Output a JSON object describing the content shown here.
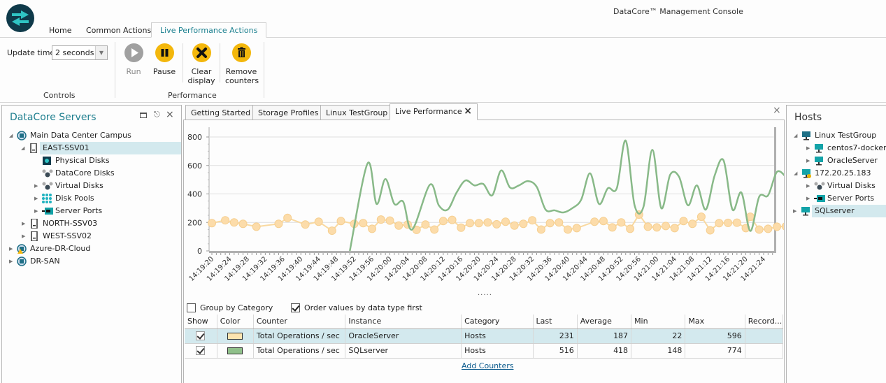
{
  "app": {
    "title": "DataCore™ Management Console",
    "logo_icon": "swap-arrows-icon"
  },
  "ribbon": {
    "tabs": [
      {
        "label": "Home",
        "active": false
      },
      {
        "label": "Common Actions",
        "active": false
      },
      {
        "label": "Live Performance Actions",
        "active": true
      }
    ],
    "controls": {
      "update_time_label": "Update time:",
      "update_time_value": "2 seconds",
      "group_label": "Controls"
    },
    "performance": {
      "group_label": "Performance",
      "buttons": [
        {
          "label": "Run",
          "icon": "play-icon",
          "enabled": false
        },
        {
          "label": "Pause",
          "icon": "pause-icon",
          "enabled": true
        },
        {
          "label_line1": "Clear",
          "label_line2": "display",
          "icon": "clear-x-icon",
          "enabled": true
        },
        {
          "label_line1": "Remove",
          "label_line2": "counters",
          "icon": "trash-icon",
          "enabled": true
        }
      ]
    }
  },
  "left_panel": {
    "title": "DataCore Servers",
    "buttons": {
      "maximize": "maximize-icon",
      "pin": "pin-icon",
      "close": "close-icon"
    },
    "tree": [
      {
        "label": "Main Data Center Campus",
        "level": 0,
        "expanded": true,
        "icon": "server-group-icon"
      },
      {
        "label": "EAST-SSV01",
        "level": 1,
        "expanded": true,
        "selected": true,
        "icon": "server-icon"
      },
      {
        "label": "Physical Disks",
        "level": 2,
        "icon": "physical-disk-icon"
      },
      {
        "label": "DataCore Disks",
        "level": 2,
        "icon": "datacore-disks-icon"
      },
      {
        "label": "Virtual Disks",
        "level": 2,
        "collapsed": true,
        "icon": "virtual-disks-icon"
      },
      {
        "label": "Disk Pools",
        "level": 2,
        "collapsed": true,
        "icon": "disk-pools-icon"
      },
      {
        "label": "Server Ports",
        "level": 2,
        "collapsed": true,
        "icon": "server-ports-icon"
      },
      {
        "label": "NORTH-SSV03",
        "level": 1,
        "collapsed": true,
        "icon": "server-icon"
      },
      {
        "label": "WEST-SSV02",
        "level": 1,
        "collapsed": true,
        "icon": "server-icon"
      },
      {
        "label": "Azure-DR-Cloud",
        "level": 0,
        "collapsed": true,
        "icon": "server-group-warning-icon"
      },
      {
        "label": "DR-SAN",
        "level": 0,
        "collapsed": true,
        "icon": "server-group-icon"
      }
    ]
  },
  "right_panel": {
    "title": "Hosts",
    "tree": [
      {
        "label": "Linux TestGroup",
        "level": 0,
        "expanded": true,
        "icon": "host-group-icon"
      },
      {
        "label": "centos7-docker",
        "level": 1,
        "collapsed": true,
        "icon": "host-icon"
      },
      {
        "label": "OracleServer",
        "level": 1,
        "collapsed": true,
        "icon": "host-icon"
      },
      {
        "label": "172.20.25.183",
        "level": 0,
        "expanded": true,
        "icon": "host-warning-icon"
      },
      {
        "label": "Virtual Disks",
        "level": 1,
        "collapsed": true,
        "icon": "virtual-disks-icon"
      },
      {
        "label": "Server Ports",
        "level": 1,
        "collapsed": true,
        "icon": "server-ports-icon"
      },
      {
        "label": "SQLserver",
        "level": 0,
        "collapsed": true,
        "selected": true,
        "icon": "host-icon"
      }
    ]
  },
  "doc_tabs": [
    {
      "label": "Getting Started",
      "active": false
    },
    {
      "label": "Storage Profiles",
      "active": false
    },
    {
      "label": "Linux TestGroup",
      "active": false
    },
    {
      "label": "Live Performance",
      "active": true,
      "closable": true
    }
  ],
  "chart_data": {
    "type": "line",
    "title": "",
    "xlabel": "",
    "ylabel": "",
    "ylim": [
      0,
      850
    ],
    "yticks": [
      0,
      200,
      400,
      600,
      800
    ],
    "grid": true,
    "xtick_labels": [
      "14:19:20",
      "14:19:24",
      "14:19:28",
      "14:19:32",
      "14:19:36",
      "14:19:40",
      "14:19:44",
      "14:19:48",
      "14:19:52",
      "14:19:56",
      "14:20:00",
      "14:20:04",
      "14:20:08",
      "14:20:12",
      "14:20:16",
      "14:20:20",
      "14:20:24",
      "14:20:28",
      "14:20:32",
      "14:20:36",
      "14:20:40",
      "14:20:44",
      "14:20:48",
      "14:20:52",
      "14:20:56",
      "14:21:00",
      "14:21:04",
      "14:21:08",
      "14:21:12",
      "14:21:16",
      "14:21:20",
      "14:21:24"
    ],
    "x_seconds_start": 0,
    "x_seconds_end": 128,
    "series": [
      {
        "name": "OracleServer - Total Operations / sec",
        "color": "#f9d9a0",
        "markers": true,
        "smooth": false,
        "points": [
          [
            0,
            195
          ],
          [
            3,
            215
          ],
          [
            5,
            200
          ],
          [
            7,
            190
          ],
          [
            10,
            170
          ],
          [
            15,
            190
          ],
          [
            17,
            232
          ],
          [
            21,
            185
          ],
          [
            24,
            205
          ],
          [
            27,
            142
          ],
          [
            29,
            210
          ],
          [
            32,
            190
          ],
          [
            34,
            195
          ],
          [
            36,
            155
          ],
          [
            38,
            220
          ],
          [
            40,
            213
          ],
          [
            42,
            178
          ],
          [
            44,
            185
          ],
          [
            46,
            148
          ],
          [
            48,
            185
          ],
          [
            50,
            150
          ],
          [
            52,
            210
          ],
          [
            54,
            218
          ],
          [
            56,
            163
          ],
          [
            58,
            195
          ],
          [
            60,
            195
          ],
          [
            62,
            200
          ],
          [
            64,
            187
          ],
          [
            66,
            205
          ],
          [
            68,
            178
          ],
          [
            70,
            190
          ],
          [
            72,
            215
          ],
          [
            74,
            150
          ],
          [
            76,
            195
          ],
          [
            78,
            200
          ],
          [
            80,
            150
          ],
          [
            82,
            160
          ],
          [
            86,
            205
          ],
          [
            88,
            210
          ],
          [
            90,
            165
          ],
          [
            92,
            200
          ],
          [
            94,
            155
          ],
          [
            96,
            255
          ],
          [
            98,
            170
          ],
          [
            100,
            165
          ],
          [
            102,
            175
          ],
          [
            104,
            160
          ],
          [
            106,
            210
          ],
          [
            108,
            190
          ],
          [
            110,
            240
          ],
          [
            112,
            145
          ],
          [
            114,
            195
          ],
          [
            116,
            197
          ],
          [
            118,
            198
          ],
          [
            120,
            160
          ],
          [
            121,
            240
          ],
          [
            123,
            150
          ],
          [
            125,
            155
          ],
          [
            127,
            170
          ],
          [
            129,
            172
          ],
          [
            131,
            230
          ]
        ]
      },
      {
        "name": "SQLserver - Total Operations / sec",
        "color": "#88b988",
        "markers": false,
        "smooth": true,
        "points": [
          [
            31,
            0
          ],
          [
            35,
            615
          ],
          [
            37,
            330
          ],
          [
            39,
            505
          ],
          [
            41,
            330
          ],
          [
            43,
            345
          ],
          [
            45,
            150
          ],
          [
            49,
            465
          ],
          [
            51,
            320
          ],
          [
            53,
            290
          ],
          [
            55,
            410
          ],
          [
            57,
            495
          ],
          [
            59,
            460
          ],
          [
            61,
            470
          ],
          [
            63,
            390
          ],
          [
            65,
            565
          ],
          [
            67,
            445
          ],
          [
            69,
            460
          ],
          [
            71,
            490
          ],
          [
            73,
            450
          ],
          [
            75,
            290
          ],
          [
            77,
            285
          ],
          [
            79,
            270
          ],
          [
            81,
            300
          ],
          [
            83,
            360
          ],
          [
            85,
            545
          ],
          [
            87,
            330
          ],
          [
            89,
            440
          ],
          [
            91,
            440
          ],
          [
            93,
            775
          ],
          [
            95,
            320
          ],
          [
            97,
            310
          ],
          [
            99,
            710
          ],
          [
            101,
            300
          ],
          [
            103,
            535
          ],
          [
            105,
            520
          ],
          [
            107,
            320
          ],
          [
            109,
            460
          ],
          [
            111,
            290
          ],
          [
            113,
            530
          ],
          [
            115,
            635
          ],
          [
            117,
            290
          ],
          [
            119,
            410
          ],
          [
            121,
            140
          ],
          [
            123,
            380
          ],
          [
            125,
            390
          ],
          [
            127,
            555
          ],
          [
            129,
            520
          ]
        ]
      }
    ]
  },
  "options": {
    "group_by_category": {
      "label": "Group by Category",
      "checked": false
    },
    "order_by_type": {
      "label": "Order values by data type first",
      "checked": true
    }
  },
  "grid": {
    "columns": [
      "Show",
      "Color",
      "Counter",
      "Instance",
      "Category",
      "Last",
      "Average",
      "Min",
      "Max",
      "Record..."
    ],
    "rows": [
      {
        "show": true,
        "color": "#fde4b0",
        "counter": "Total Operations / sec",
        "instance": "OracleServer",
        "category": "Hosts",
        "last": "231",
        "average": "187",
        "min": "22",
        "max": "596",
        "record": "",
        "selected": true
      },
      {
        "show": true,
        "color": "#8fc08a",
        "counter": "Total Operations / sec",
        "instance": "SQLserver",
        "category": "Hosts",
        "last": "516",
        "average": "418",
        "min": "148",
        "max": "774",
        "record": "",
        "selected": false
      }
    ],
    "add_counters_label": "Add Counters"
  }
}
